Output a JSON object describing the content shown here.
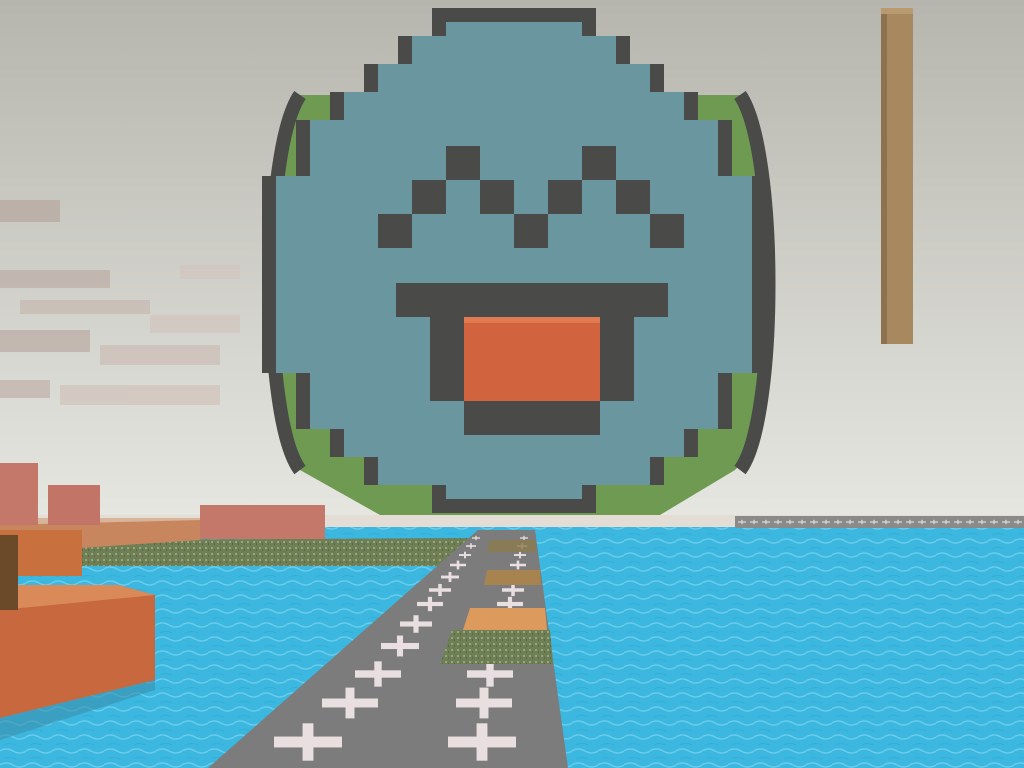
{
  "game": {
    "view": "first-person",
    "style": "voxel-block-world"
  },
  "colors": {
    "sky_top": "#b6b6ae",
    "sky_bottom": "#e7e7e2",
    "water": "#3cb7df",
    "water_light": "#6fd0ee",
    "road": "#7c7c7c",
    "road_mark": "#e9dfe0",
    "face_fill": "#6a979f",
    "face_outline": "#4a4a48",
    "face_back_green": "#6f9a52",
    "tongue": "#d2633f",
    "terracotta": "#c86a45",
    "brick": "#c4786a",
    "pole": "#a8885f",
    "grass": "#6c8a55"
  },
  "scene_objects": [
    {
      "name": "sky",
      "icon": "sky-gradient"
    },
    {
      "name": "ocean",
      "icon": "water-surface"
    },
    {
      "name": "runway",
      "icon": "road-with-plus-marks"
    },
    {
      "name": "giant-smiley-balloon",
      "icon": "pixel-face-tongue-out"
    },
    {
      "name": "floating-wood-pole",
      "icon": "wooden-post"
    },
    {
      "name": "left-shore-blocks",
      "icon": "terracotta-blocks"
    },
    {
      "name": "far-pier",
      "icon": "dock-with-plus-marks"
    }
  ]
}
